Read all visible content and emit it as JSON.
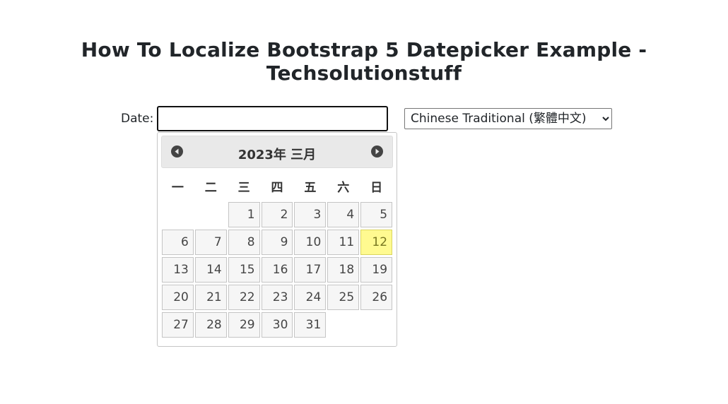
{
  "page": {
    "title": "How To Localize Bootstrap 5 Datepicker Example - Techsolutionstuff"
  },
  "form": {
    "date_label": "Date:",
    "date_value": "",
    "language_select": {
      "selected": "Chinese Traditional (繁體中文)"
    }
  },
  "datepicker": {
    "title": "2023年 三月",
    "prev_icon": "circle-triangle-left-icon",
    "next_icon": "circle-triangle-right-icon",
    "weekdays": [
      "一",
      "二",
      "三",
      "四",
      "五",
      "六",
      "日"
    ],
    "weeks": [
      [
        "",
        "",
        "1",
        "2",
        "3",
        "4",
        "5"
      ],
      [
        "6",
        "7",
        "8",
        "9",
        "10",
        "11",
        "12"
      ],
      [
        "13",
        "14",
        "15",
        "16",
        "17",
        "18",
        "19"
      ],
      [
        "20",
        "21",
        "22",
        "23",
        "24",
        "25",
        "26"
      ],
      [
        "27",
        "28",
        "29",
        "30",
        "31",
        "",
        ""
      ]
    ],
    "today": "12",
    "colors": {
      "today_bg": "#fffa90",
      "cell_bg": "#f6f6f6",
      "header_bg": "#e9e9e9"
    }
  }
}
